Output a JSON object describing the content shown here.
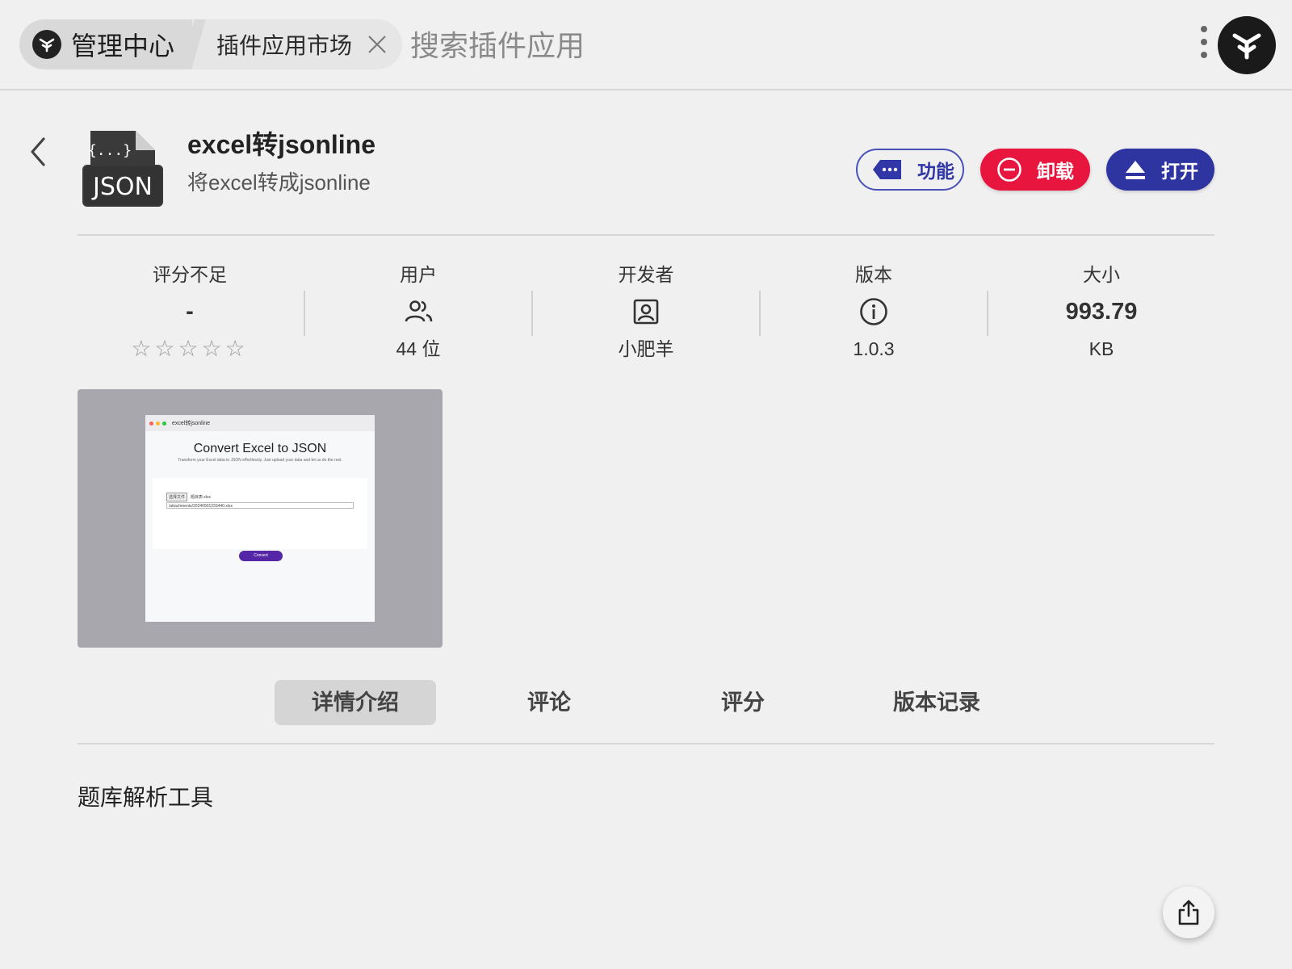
{
  "topbar": {
    "home_label": "管理中心",
    "app_tab_label": "插件应用市场",
    "search_placeholder": "搜索插件应用"
  },
  "app": {
    "name": "excel转jsonline",
    "description": "将excel转成jsonline",
    "icon_text": "JSON",
    "icon_braces": "{...}"
  },
  "actions": {
    "features_label": "功能",
    "uninstall_label": "卸载",
    "open_label": "打开"
  },
  "colors": {
    "features": "#3137a6",
    "uninstall": "#e8163f",
    "open": "#2f35a0"
  },
  "stats": {
    "rating": {
      "title": "评分不足",
      "value": "-",
      "stars": "☆☆☆☆☆",
      "rating_value": 0,
      "max_stars": 5
    },
    "users": {
      "title": "用户",
      "icon": "users-icon",
      "value": "44 位"
    },
    "developer": {
      "title": "开发者",
      "icon": "person-card-icon",
      "value": "小肥羊"
    },
    "version": {
      "title": "版本",
      "icon": "info-icon",
      "value": "1.0.3"
    },
    "size": {
      "title": "大小",
      "value": "993.79",
      "unit": "KB"
    }
  },
  "screenshot": {
    "window_title": "excel转jsonline",
    "heading": "Convert Excel to JSON",
    "subheading": "Transform your Excel data to JSON effortlessly. Just upload your data and let us do the rest.",
    "choose_button": "选择文件",
    "chosen_file": "题目表.xlsx",
    "path_value": "/attachments/20240901233440.xlsx",
    "convert_button": "Convert"
  },
  "tabs": [
    {
      "label": "详情介绍",
      "active": true
    },
    {
      "label": "评论",
      "active": false
    },
    {
      "label": "评分",
      "active": false
    },
    {
      "label": "版本记录",
      "active": false
    }
  ],
  "content": {
    "detail_text": "题库解析工具"
  }
}
